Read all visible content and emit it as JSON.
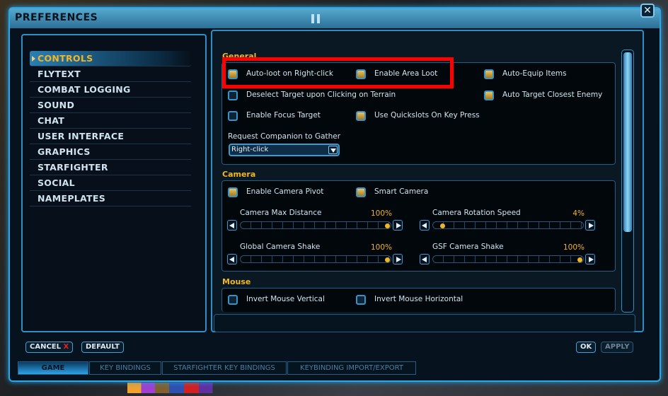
{
  "window": {
    "title": "PREFERENCES",
    "close_label": "✕"
  },
  "sidebar": {
    "items": [
      {
        "label": "CONTROLS",
        "active": true
      },
      {
        "label": "FLYTEXT"
      },
      {
        "label": "COMBAT LOGGING"
      },
      {
        "label": "SOUND"
      },
      {
        "label": "CHAT"
      },
      {
        "label": "USER INTERFACE"
      },
      {
        "label": "GRAPHICS"
      },
      {
        "label": "STARFIGHTER"
      },
      {
        "label": "SOCIAL"
      },
      {
        "label": "NAMEPLATES"
      }
    ]
  },
  "general": {
    "title": "General",
    "checkboxes": [
      {
        "label": "Auto-loot on Right-click",
        "checked": true
      },
      {
        "label": "Enable Area Loot",
        "checked": true
      },
      {
        "label": "Auto-Equip Items",
        "checked": true
      },
      {
        "label": "Deselect Target upon Clicking on Terrain",
        "checked": false
      },
      {
        "label": "Auto Target Closest Enemy",
        "checked": true
      },
      {
        "label": "Enable Focus Target",
        "checked": false
      },
      {
        "label": "Use Quickslots On Key Press",
        "checked": true
      }
    ],
    "dropdown_label": "Request Companion to Gather",
    "dropdown_value": "Right-click"
  },
  "camera": {
    "title": "Camera",
    "checkboxes": [
      {
        "label": "Enable Camera Pivot",
        "checked": true
      },
      {
        "label": "Smart Camera",
        "checked": true
      }
    ],
    "sliders": [
      {
        "label": "Camera Max Distance",
        "value_text": "100%",
        "value": 100
      },
      {
        "label": "Camera Rotation Speed",
        "value_text": "4%",
        "value": 4
      },
      {
        "label": "Global Camera Shake",
        "value_text": "100%",
        "value": 100
      },
      {
        "label": "GSF Camera Shake",
        "value_text": "100%",
        "value": 100
      }
    ]
  },
  "mouse": {
    "title": "Mouse",
    "checkboxes": [
      {
        "label": "Invert Mouse Vertical",
        "checked": false
      },
      {
        "label": "Invert Mouse Horizontal",
        "checked": false
      }
    ]
  },
  "buttons": {
    "cancel": "CANCEL",
    "cancel_x": "X",
    "default": "DEFAULT",
    "ok": "OK",
    "apply": "APPLY"
  },
  "tabs": [
    {
      "label": "GAME",
      "active": true
    },
    {
      "label": "KEY BINDINGS"
    },
    {
      "label": "STARFIGHTER KEY BINDINGS"
    },
    {
      "label": "KEYBINDING IMPORT/EXPORT"
    }
  ],
  "colors": {
    "accent": "#f2b526",
    "frame": "#2fa6e0",
    "highlight": "#ff0000"
  }
}
